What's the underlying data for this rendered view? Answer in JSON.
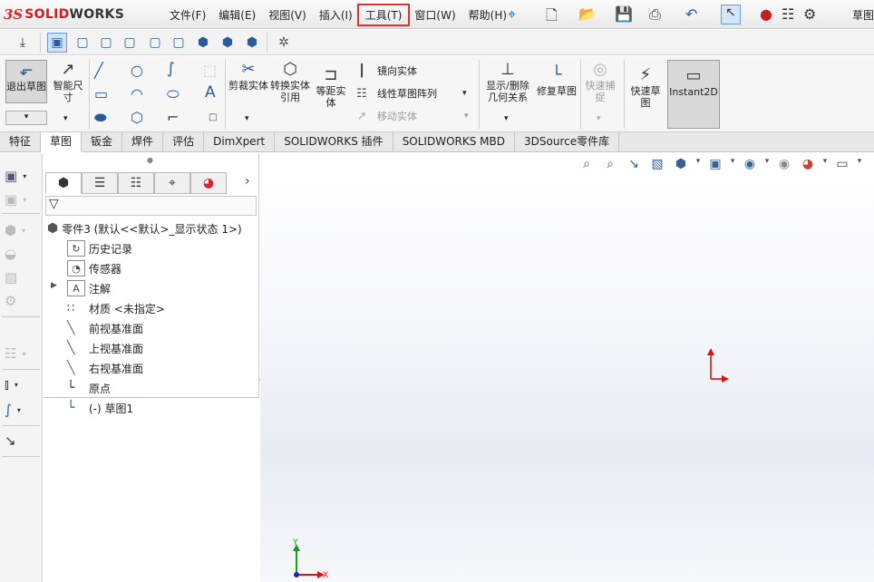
{
  "app": {
    "brand_ds": "3S",
    "brand_solid": "SOLID",
    "brand_works": "WORKS"
  },
  "menu": [
    "文件(F)",
    "编辑(E)",
    "视图(V)",
    "插入(I)",
    "工具(T)",
    "窗口(W)",
    "帮助(H)"
  ],
  "menu_highlighted": "工具(T)",
  "top_right_label": "草图",
  "ribbon": {
    "exit_sketch": "退出草图",
    "smart_dim": "智能尺寸",
    "trim": "剪裁实体",
    "convert": "转换实体引用",
    "offset": "等距实体",
    "mirror": "镜向实体",
    "linear_pattern": "线性草图阵列",
    "move": "移动实体",
    "show_relations": "显示/删除几何关系",
    "repair": "修复草图",
    "quick_snap": "快速捕捉",
    "rapid_sketch": "快速草图",
    "instant2d": "Instant2D"
  },
  "tabs": [
    "特征",
    "草图",
    "钣金",
    "焊件",
    "评估",
    "DimXpert",
    "SOLIDWORKS 插件",
    "SOLIDWORKS MBD",
    "3DSource零件库"
  ],
  "active_tab": "草图",
  "tree": {
    "root": "零件3  (默认<<默认>_显示状态 1>)",
    "items": [
      "历史记录",
      "传感器",
      "注解",
      "材质 <未指定>",
      "前视基准面",
      "上视基准面",
      "右视基准面",
      "原点",
      "(-) 草图1"
    ]
  },
  "triad": {
    "x": "X",
    "y": "Y"
  },
  "colors": {
    "highlight": "#e03030",
    "axis_red": "#e01010",
    "axis_green": "#10a010",
    "accent_blue": "#2a5a9a"
  }
}
